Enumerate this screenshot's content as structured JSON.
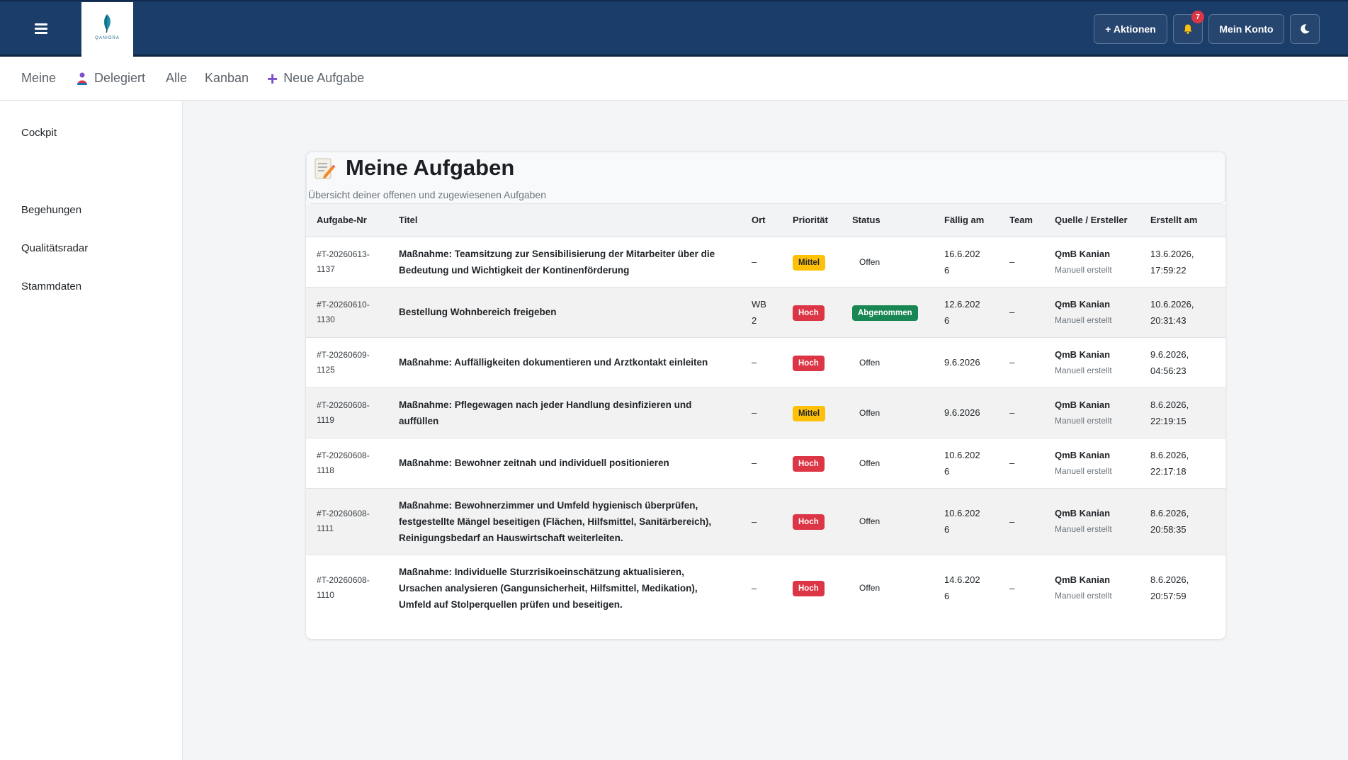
{
  "header": {
    "logo_text": "QANIORA",
    "actions_label": "+ Aktionen",
    "notification_count": "7",
    "account_label": "Mein Konto"
  },
  "subnav": {
    "items": [
      {
        "label": "Meine"
      },
      {
        "label": "Delegiert"
      },
      {
        "label": "Alle"
      },
      {
        "label": "Kanban"
      },
      {
        "label": "Neue Aufgabe"
      }
    ]
  },
  "sidebar": {
    "items": [
      {
        "label": "Cockpit"
      },
      {
        "label": "Begehungen"
      },
      {
        "label": "Qualitätsradar"
      },
      {
        "label": "Stammdaten"
      }
    ]
  },
  "main": {
    "title": "Meine Aufgaben",
    "subtitle": "Übersicht deiner offenen und zugewiesenen Aufgaben",
    "columns": [
      "Aufgabe-Nr",
      "Titel",
      "Ort",
      "Priorität",
      "Status",
      "Fällig am",
      "Team",
      "Quelle / Ersteller",
      "Erstellt am"
    ],
    "rows": [
      {
        "id1": "#T-20260613-",
        "id2": "1137",
        "title": "Maßnahme: Teamsitzung zur Sensibilisierung der Mitarbeiter über die Bedeutung und Wichtigkeit der Kontinenförderung",
        "ort": "–",
        "priority": "Mittel",
        "status": "Offen",
        "due1": "16.6.202",
        "due2": "6",
        "team": "–",
        "source": "QmB Kanian",
        "source_sub": "Manuell erstellt",
        "created1": "13.6.2026,",
        "created2": "17:59:22"
      },
      {
        "id1": "#T-20260610-",
        "id2": "1130",
        "title": "Bestellung Wohnbereich freigeben",
        "ort": "WB 2",
        "priority": "Hoch",
        "status": "Abgenommen",
        "due1": "12.6.202",
        "due2": "6",
        "team": "–",
        "source": "QmB Kanian",
        "source_sub": "Manuell erstellt",
        "created1": "10.6.2026,",
        "created2": "20:31:43"
      },
      {
        "id1": "#T-20260609-",
        "id2": "1125",
        "title": "Maßnahme: Auffälligkeiten dokumentieren und Arztkontakt einleiten",
        "ort": "–",
        "priority": "Hoch",
        "status": "Offen",
        "due1": "9.6.2026",
        "due2": "",
        "team": "–",
        "source": "QmB Kanian",
        "source_sub": "Manuell erstellt",
        "created1": "9.6.2026,",
        "created2": "04:56:23"
      },
      {
        "id1": "#T-20260608-",
        "id2": "1119",
        "title": "Maßnahme: Pflegewagen nach jeder Handlung desinfizieren und auffüllen",
        "ort": "–",
        "priority": "Mittel",
        "status": "Offen",
        "due1": "9.6.2026",
        "due2": "",
        "team": "–",
        "source": "QmB Kanian",
        "source_sub": "Manuell erstellt",
        "created1": "8.6.2026,",
        "created2": "22:19:15"
      },
      {
        "id1": "#T-20260608-",
        "id2": "1118",
        "title": "Maßnahme: Bewohner zeitnah und individuell positionieren",
        "ort": "–",
        "priority": "Hoch",
        "status": "Offen",
        "due1": "10.6.202",
        "due2": "6",
        "team": "–",
        "source": "QmB Kanian",
        "source_sub": "Manuell erstellt",
        "created1": "8.6.2026,",
        "created2": "22:17:18"
      },
      {
        "id1": "#T-20260608-",
        "id2": "1111",
        "title": "Maßnahme: Bewohnerzimmer und Umfeld hygienisch überprüfen, festgestellte Mängel beseitigen (Flächen, Hilfsmittel, Sanitärbereich), Reinigungsbedarf an Hauswirtschaft weiterleiten.",
        "ort": "–",
        "priority": "Hoch",
        "status": "Offen",
        "due1": "10.6.202",
        "due2": "6",
        "team": "–",
        "source": "QmB Kanian",
        "source_sub": "Manuell erstellt",
        "created1": "8.6.2026,",
        "created2": "20:58:35"
      },
      {
        "id1": "#T-20260608-",
        "id2": "1110",
        "title": "Maßnahme: Individuelle Sturzrisikoeinschätzung aktualisieren, Ursachen analysieren (Gangunsicherheit, Hilfsmittel, Medikation), Umfeld auf Stolperquellen prüfen und beseitigen.",
        "ort": "–",
        "priority": "Hoch",
        "status": "Offen",
        "due1": "14.6.202",
        "due2": "6",
        "team": "–",
        "source": "QmB Kanian",
        "source_sub": "Manuell erstellt",
        "created1": "8.6.2026,",
        "created2": "20:57:59"
      }
    ]
  },
  "colors": {
    "topbar": "#1b3d6a",
    "hoch": "#dc3545",
    "mittel": "#ffc107",
    "abgenommen": "#198754",
    "accent": "#7a4fc9"
  }
}
